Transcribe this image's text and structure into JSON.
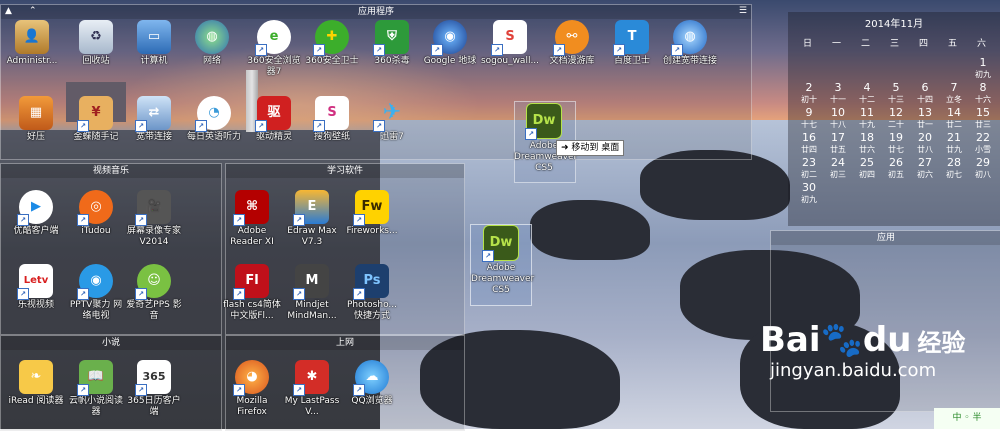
{
  "fences": {
    "apps_title": "应用程序",
    "video_title": "视频音乐",
    "study_title": "学习软件",
    "novel_title": "小说",
    "net_title": "上网",
    "app_title": "应用"
  },
  "icons": {
    "administrator": "Administr...",
    "recycle": "回收站",
    "computer": "计算机",
    "network": "网络",
    "browser360": "360安全浏览器7",
    "guard360": "360安全卫士",
    "antivirus360": "360杀毒",
    "google_earth": "Google 地球",
    "sogou_wall": "sogou_wall...",
    "wenjuan": "文档漫游库",
    "baidu_guard": "百度卫士",
    "shortcut": "创建宽带连接",
    "haoya": "好压",
    "jinfeng": "金蝶随手记",
    "broadband": "宽带连接",
    "daily_english": "每日英语听力",
    "driver": "驱动精灵",
    "sogou_wallpaper": "搜狗壁纸",
    "xunlei": "迅雷7",
    "dreamweaver_drag": "Adobe Dreamweaver CS5",
    "dreamweaver": "Adobe Dreamweaver CS5",
    "youku": "优酷客户端",
    "itudou": "iTudou",
    "screen_rec": "屏幕录像专家V2014",
    "letv": "乐视视频",
    "pptv": "PPTV聚力 网络电视",
    "pps": "爱奇艺PPS 影音",
    "adobe_reader": "Adobe Reader XI",
    "edraw": "Edraw Max V7.3",
    "fireworks": "Fireworks...",
    "flash": "flash cs4简体中文版Fl...",
    "mindjet": "Mindjet MindMan...",
    "photoshop": "Photosho... 快捷方式",
    "iread": "iRead 阅读器",
    "yunfan": "云帆小说阅读器",
    "cal365": "365日历客户端",
    "firefox": "Mozilla Firefox",
    "lastpass": "My LastPass V...",
    "qqbrowser": "QQ浏览器"
  },
  "tooltip": "➜ 移动到 桌面",
  "calendar": {
    "title": "2014年11月",
    "weekdays": [
      "日",
      "一",
      "二",
      "三",
      "四",
      "五",
      "六"
    ],
    "rows": [
      [
        {
          "d": "",
          "l": ""
        },
        {
          "d": "",
          "l": ""
        },
        {
          "d": "",
          "l": ""
        },
        {
          "d": "",
          "l": ""
        },
        {
          "d": "",
          "l": ""
        },
        {
          "d": "",
          "l": ""
        },
        {
          "d": "1",
          "l": "初九"
        }
      ],
      [
        {
          "d": "2",
          "l": "初十"
        },
        {
          "d": "3",
          "l": "十一"
        },
        {
          "d": "4",
          "l": "十二"
        },
        {
          "d": "5",
          "l": "十三"
        },
        {
          "d": "6",
          "l": "十四"
        },
        {
          "d": "7",
          "l": "立冬"
        },
        {
          "d": "8",
          "l": "十六"
        }
      ],
      [
        {
          "d": "9",
          "l": "十七"
        },
        {
          "d": "10",
          "l": "十八"
        },
        {
          "d": "11",
          "l": "十九"
        },
        {
          "d": "12",
          "l": "二十"
        },
        {
          "d": "13",
          "l": "廿一"
        },
        {
          "d": "14",
          "l": "廿二"
        },
        {
          "d": "15",
          "l": "廿三"
        }
      ],
      [
        {
          "d": "16",
          "l": "廿四"
        },
        {
          "d": "17",
          "l": "廿五"
        },
        {
          "d": "18",
          "l": "廿六"
        },
        {
          "d": "19",
          "l": "廿七"
        },
        {
          "d": "20",
          "l": "廿八"
        },
        {
          "d": "21",
          "l": "廿九"
        },
        {
          "d": "22",
          "l": "小雪"
        }
      ],
      [
        {
          "d": "23",
          "l": "初二"
        },
        {
          "d": "24",
          "l": "初三"
        },
        {
          "d": "25",
          "l": "初四"
        },
        {
          "d": "26",
          "l": "初五"
        },
        {
          "d": "27",
          "l": "初六"
        },
        {
          "d": "28",
          "l": "初七"
        },
        {
          "d": "29",
          "l": "初八"
        }
      ],
      [
        {
          "d": "30",
          "l": "初九"
        },
        {
          "d": "",
          "l": ""
        },
        {
          "d": "",
          "l": ""
        },
        {
          "d": "",
          "l": ""
        },
        {
          "d": "",
          "l": ""
        },
        {
          "d": "",
          "l": ""
        },
        {
          "d": "",
          "l": ""
        }
      ]
    ]
  },
  "watermark": {
    "brand": "Bai",
    "paw": "du",
    "sub": "经验",
    "url": "jingyan.baidu.com"
  },
  "tray": "中 ◦ 半"
}
